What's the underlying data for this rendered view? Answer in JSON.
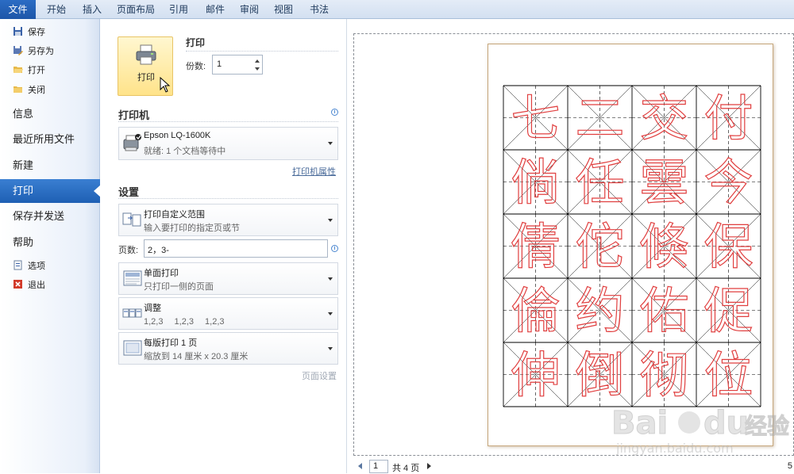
{
  "ribbon": {
    "tabs": [
      "文件",
      "开始",
      "插入",
      "页面布局",
      "引用",
      "邮件",
      "审阅",
      "视图",
      "书法"
    ]
  },
  "sidebar": {
    "small_top": [
      {
        "label": "保存",
        "icon": "save-icon"
      },
      {
        "label": "另存为",
        "icon": "save-as-icon"
      },
      {
        "label": "打开",
        "icon": "folder-open-icon"
      },
      {
        "label": "关闭",
        "icon": "folder-close-icon"
      }
    ],
    "big": [
      "信息",
      "最近所用文件",
      "新建",
      "打印",
      "保存并发送",
      "帮助"
    ],
    "active": "打印",
    "small_bottom": [
      {
        "label": "选项",
        "icon": "options-icon"
      },
      {
        "label": "退出",
        "icon": "exit-icon"
      }
    ]
  },
  "print": {
    "button_label": "打印",
    "section_title": "打印",
    "copies_label": "份数:",
    "copies_value": "1"
  },
  "printer": {
    "section_title": "打印机",
    "name": "Epson LQ-1600K",
    "status": "就绪: 1 个文档等待中",
    "properties_link": "打印机属性"
  },
  "settings": {
    "section_title": "设置",
    "range_title": "打印自定义范围",
    "range_desc": "输入要打印的指定页或节",
    "pages_label": "页数:",
    "pages_value": "2，3-",
    "sides_title": "单面打印",
    "sides_desc": "只打印一侧的页面",
    "collate_title": "调整",
    "collate_desc": "1,2,3　 1,2,3　 1,2,3",
    "perpage_title": "每版打印 1 页",
    "perpage_desc": "缩放到 14 厘米 x 20.3 厘米",
    "page_setup_link": "页面设置"
  },
  "preview": {
    "characters": [
      "七",
      "二",
      "交",
      "付",
      "倘",
      "任",
      "雲",
      "今",
      "倩",
      "佗",
      "倏",
      "保",
      "倫",
      "约",
      "佑",
      "促",
      "伸",
      "倒",
      "彻",
      "位"
    ],
    "glyph_color": "#e04040",
    "current_page": "1",
    "total_pages": "共 4 页",
    "zoom_fragment": "5"
  },
  "watermark": {
    "brand": "Bai du 经验",
    "url": "jingyan.baidu.com"
  }
}
